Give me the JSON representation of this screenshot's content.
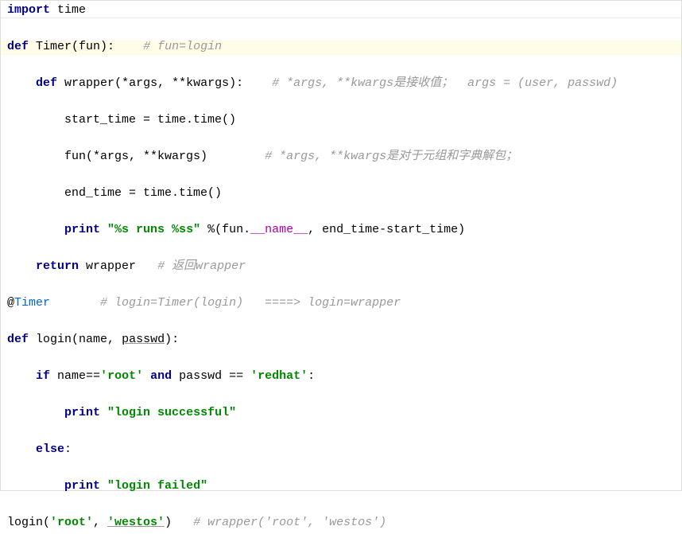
{
  "code": {
    "lines": [
      {
        "type": "import",
        "keyword": "import",
        "module": "time"
      },
      {
        "type": "blank"
      },
      {
        "type": "funcdef",
        "keyword": "def",
        "name": "Timer",
        "params": "(fun):",
        "indent": 0,
        "comment": "# fun=login",
        "highlighted": true
      },
      {
        "type": "blank"
      },
      {
        "type": "funcdef",
        "keyword": "def",
        "name": "wrapper",
        "params": "(*args, **kwargs):",
        "indent": 1,
        "comment": "# *args, **kwargs是接收值；  args = (user, passwd)"
      },
      {
        "type": "blank"
      },
      {
        "type": "stmt",
        "text": "start_time = time.time()",
        "indent": 2
      },
      {
        "type": "blank"
      },
      {
        "type": "stmt",
        "text": "fun(*args, **kwargs)",
        "indent": 2,
        "comment": "# *args, **kwargs是对于元组和字典解包；"
      },
      {
        "type": "blank"
      },
      {
        "type": "stmt",
        "text": "end_time = time.time()",
        "indent": 2
      },
      {
        "type": "blank"
      },
      {
        "type": "print",
        "keyword": "print",
        "string": "\"%s runs %ss\"",
        "rest": " %(fun.",
        "special": "__name__",
        "rest2": ", end_time-start_time)",
        "indent": 2
      },
      {
        "type": "blank"
      },
      {
        "type": "return",
        "keyword": "return",
        "value": "wrapper",
        "indent": 1,
        "comment": "# 返回wrapper"
      },
      {
        "type": "blank"
      },
      {
        "type": "decorator",
        "at": "@",
        "name": "Timer",
        "comment": "# login=Timer(login)   ====> login=wrapper"
      },
      {
        "type": "blank"
      },
      {
        "type": "funcdef",
        "keyword": "def",
        "name": "login",
        "params": "(name, passwd):",
        "indent": 0,
        "underline_param": "passwd"
      },
      {
        "type": "blank"
      },
      {
        "type": "if",
        "keyword": "if",
        "cond_pre": "name==",
        "str1": "'root'",
        "and": "and",
        "cond_mid": " passwd == ",
        "str2": "'redhat'",
        "colon": ":",
        "indent": 1
      },
      {
        "type": "blank"
      },
      {
        "type": "print",
        "keyword": "print",
        "string": "\"login successful\"",
        "indent": 2
      },
      {
        "type": "blank"
      },
      {
        "type": "else",
        "keyword": "else",
        "colon": ":",
        "indent": 1
      },
      {
        "type": "blank"
      },
      {
        "type": "print",
        "keyword": "print",
        "string": "\"login failed\"",
        "indent": 2
      },
      {
        "type": "blank"
      },
      {
        "type": "call",
        "pre": "login(",
        "str1": "'root'",
        "mid": ", ",
        "str2": "'westos'",
        "post": ")",
        "indent": 0,
        "comment": "# wrapper('root', 'westos')",
        "underline_str": true
      }
    ]
  }
}
